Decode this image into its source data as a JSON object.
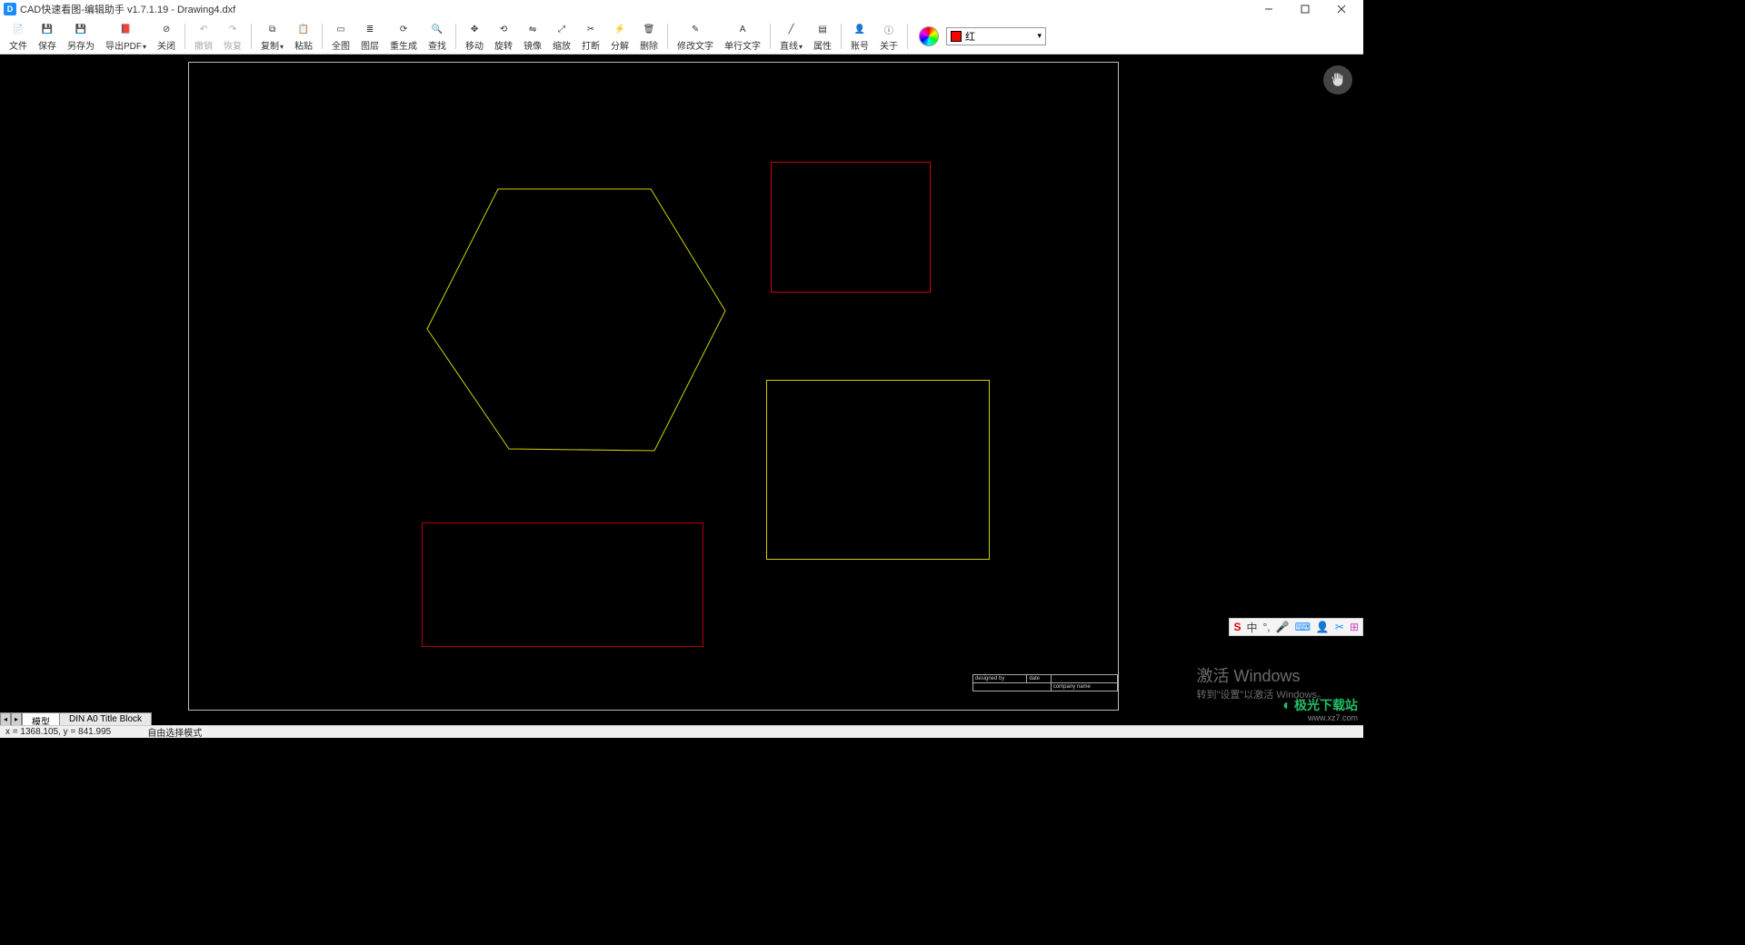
{
  "window": {
    "title": "CAD快速看图-编辑助手 v1.7.1.19 - Drawing4.dxf"
  },
  "toolbar": {
    "file": "文件",
    "save": "保存",
    "save_as": "另存为",
    "export_pdf": "导出PDF",
    "close": "关闭",
    "undo": "撤销",
    "redo": "恢复",
    "copy": "复制",
    "paste": "粘贴",
    "full_view": "全图",
    "layers": "图层",
    "regen": "重生成",
    "find": "查找",
    "move": "移动",
    "rotate": "旋转",
    "mirror": "镜像",
    "scale": "缩放",
    "break": "打断",
    "explode": "分解",
    "delete": "删除",
    "edit_text": "修改文字",
    "single_text": "单行文字",
    "line": "直线",
    "properties": "属性",
    "account": "账号",
    "about": "关于"
  },
  "color": {
    "label": "红"
  },
  "tabs": {
    "model": "模型",
    "layout1": "DIN A0 Title Block"
  },
  "status": {
    "coords": "x = 1368.105, y = 841.995",
    "mode": "自由选择模式"
  },
  "activate": {
    "l1": "激活 Windows",
    "l2": "转到\"设置\"以激活 Windows。"
  },
  "ime": {
    "ch": "中"
  },
  "titleblock": {
    "designed": "designed by",
    "date": "date",
    "company": "company name"
  },
  "watermark": {
    "brand": "极光下载站",
    "url": "www.xz7.com"
  }
}
